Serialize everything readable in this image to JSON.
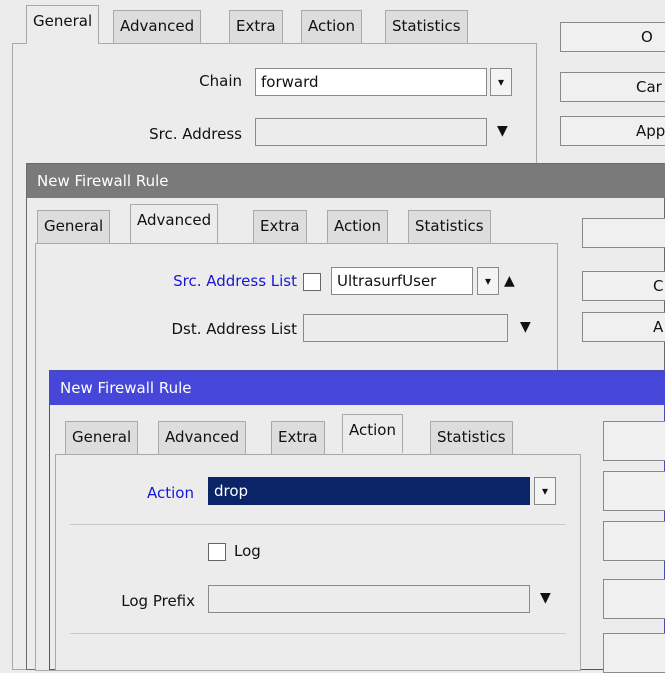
{
  "win1": {
    "tabs": [
      "General",
      "Advanced",
      "Extra",
      "Action",
      "Statistics"
    ],
    "chain_label": "Chain",
    "chain_value": "forward",
    "src_address_label": "Src. Address",
    "src_address_value": "",
    "buttons": [
      "O",
      "Car",
      "App"
    ]
  },
  "win2": {
    "title": "New Firewall Rule",
    "tabs": [
      "General",
      "Advanced",
      "Extra",
      "Action",
      "Statistics"
    ],
    "src_list_label": "Src. Address List",
    "src_list_value": "UltrasurfUser",
    "dst_list_label": "Dst. Address List",
    "dst_list_value": "",
    "buttons": [
      "",
      "C",
      "A"
    ]
  },
  "win3": {
    "title": "New Firewall Rule",
    "tabs": [
      "General",
      "Advanced",
      "Extra",
      "Action",
      "Statistics"
    ],
    "action_label": "Action",
    "action_value": "drop",
    "log_label": "Log",
    "log_prefix_label": "Log Prefix",
    "log_prefix_value": ""
  },
  "colors": {
    "title_gray": "#7a7a7a",
    "title_blue": "#4646d8",
    "selection": "#0b2468",
    "label_blue": "#1717d6"
  }
}
